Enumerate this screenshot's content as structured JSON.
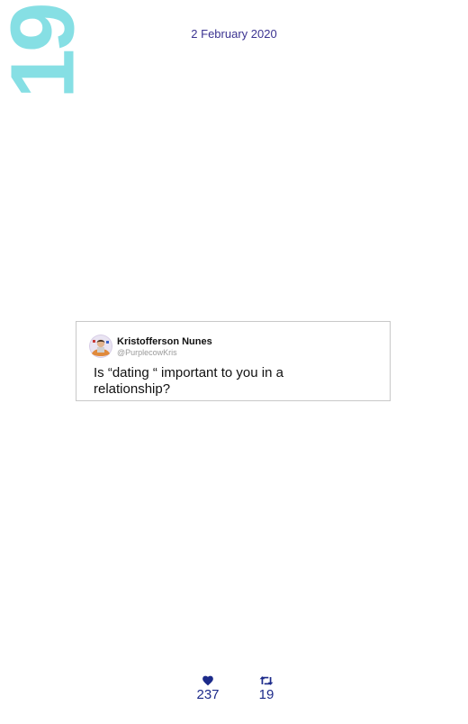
{
  "page_number": "19",
  "date": "2 February 2020",
  "tweet": {
    "author_name": "Kristofferson Nunes",
    "author_handle": "@PurplecowKris",
    "text": "Is “dating “ important to you in a relationship?"
  },
  "stats": {
    "likes": "237",
    "retweets": "19",
    "like_icon": "heart-icon",
    "retweet_icon": "retweet-icon"
  },
  "colors": {
    "page_number": "#86dfe4",
    "date_text": "#3b3391",
    "stats_text": "#1c2a8a",
    "card_border": "#c8c8c8"
  }
}
